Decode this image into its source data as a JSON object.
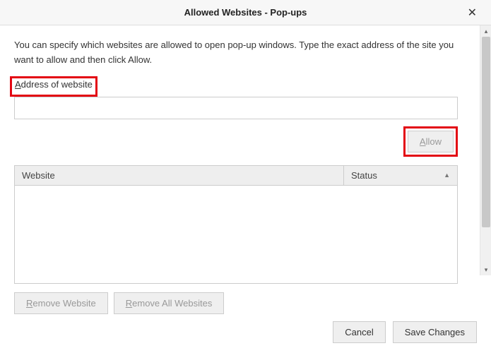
{
  "dialog": {
    "title": "Allowed Websites - Pop-ups",
    "close_symbol": "✕"
  },
  "description": "You can specify which websites are allowed to open pop-up windows. Type the exact address of the site you want to allow and then click Allow.",
  "address": {
    "label_prefix": "A",
    "label_rest": "ddress of website",
    "value": ""
  },
  "buttons": {
    "allow_prefix": "A",
    "allow_rest": "llow",
    "remove_website_prefix": "R",
    "remove_website_rest": "emove Website",
    "remove_all_prefix": "R",
    "remove_all_rest": "emove All Websites",
    "cancel": "Cancel",
    "save": "Save Changes"
  },
  "table": {
    "col_website": "Website",
    "col_status": "Status",
    "sort_caret": "▲"
  }
}
